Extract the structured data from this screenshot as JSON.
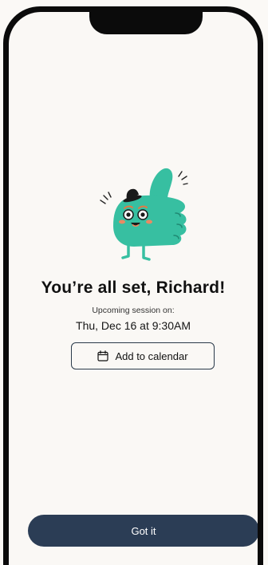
{
  "confirmation": {
    "title": "You’re all set, Richard!",
    "subtitle": "Upcoming session on:",
    "session_datetime": "Thu, Dec 16 at 9:30AM"
  },
  "actions": {
    "add_to_calendar_label": "Add to calendar",
    "got_it_label": "Got it"
  },
  "icons": {
    "calendar": "calendar-icon",
    "mascot": "thumbs-up-mascot"
  },
  "colors": {
    "background": "#faf8f5",
    "primary_button": "#2b3d55",
    "mascot_green": "#37bfa1",
    "text": "#111111"
  }
}
